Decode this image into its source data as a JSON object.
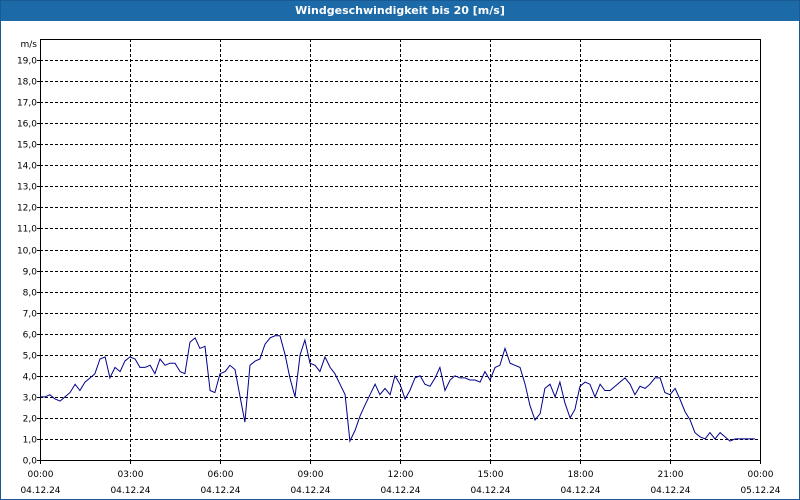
{
  "window": {
    "title": "Windgeschwindigkeit bis 20 [m/s]"
  },
  "chart_data": {
    "type": "line",
    "title": "Windgeschwindigkeit bis 20 [m/s]",
    "ylabel": "m/s",
    "xlabel": "",
    "ylim": [
      0,
      20
    ],
    "xlim": [
      0,
      24
    ],
    "grid": true,
    "line_color": "#00008b",
    "y_ticks": [
      "0,0",
      "1,0",
      "2,0",
      "3,0",
      "4,0",
      "5,0",
      "6,0",
      "7,0",
      "8,0",
      "9,0",
      "10,0",
      "11,0",
      "12,0",
      "13,0",
      "14,0",
      "15,0",
      "16,0",
      "17,0",
      "18,0",
      "19,0"
    ],
    "x_ticks": [
      {
        "time": "00:00",
        "date": "04.12.24"
      },
      {
        "time": "03:00",
        "date": "04.12.24"
      },
      {
        "time": "06:00",
        "date": "04.12.24"
      },
      {
        "time": "09:00",
        "date": "04.12.24"
      },
      {
        "time": "12:00",
        "date": "04.12.24"
      },
      {
        "time": "15:00",
        "date": "04.12.24"
      },
      {
        "time": "18:00",
        "date": "04.12.24"
      },
      {
        "time": "21:00",
        "date": "04.12.24"
      },
      {
        "time": "00:00",
        "date": "05.12.24"
      }
    ],
    "series": [
      {
        "x": [
          0,
          0.17,
          0.33,
          0.5,
          0.67,
          0.83,
          1,
          1.17,
          1.33,
          1.5,
          1.67,
          1.83,
          2,
          2.17,
          2.33,
          2.5,
          2.67,
          2.83,
          3,
          3.17,
          3.33,
          3.5,
          3.67,
          3.83,
          4,
          4.17,
          4.33,
          4.5,
          4.67,
          4.83,
          5,
          5.17,
          5.33,
          5.5,
          5.67,
          5.83,
          6,
          6.17,
          6.33,
          6.5,
          6.67,
          6.83,
          7,
          7.17,
          7.33,
          7.5,
          7.67,
          7.83,
          8,
          8.17,
          8.33,
          8.5,
          8.67,
          8.83,
          9,
          9.17,
          9.33,
          9.5,
          9.67,
          9.83,
          10,
          10.17,
          10.33,
          10.5,
          10.67,
          10.83,
          11,
          11.17,
          11.33,
          11.5,
          11.67,
          11.83,
          12,
          12.17,
          12.33,
          12.5,
          12.67,
          12.83,
          13,
          13.17,
          13.33,
          13.5,
          13.67,
          13.83,
          14,
          14.17,
          14.33,
          14.5,
          14.67,
          14.83,
          15,
          15.17,
          15.33,
          15.5,
          15.67,
          15.83,
          16,
          16.17,
          16.33,
          16.5,
          16.67,
          16.83,
          17,
          17.17,
          17.33,
          17.5,
          17.67,
          17.83,
          18,
          18.17,
          18.33,
          18.5,
          18.67,
          18.83,
          19,
          19.17,
          19.33,
          19.5,
          19.67,
          19.83,
          20,
          20.17,
          20.33,
          20.5,
          20.67,
          20.83,
          21,
          21.17,
          21.33,
          21.5,
          21.67,
          21.83,
          22,
          22.17,
          22.33,
          22.5,
          22.67,
          22.83,
          23,
          23.17,
          23.33,
          23.5,
          23.67,
          23.83
        ],
        "values": [
          3.0,
          3.0,
          3.1,
          2.9,
          2.8,
          3.0,
          3.2,
          3.6,
          3.3,
          3.7,
          3.9,
          4.1,
          4.8,
          4.9,
          3.9,
          4.4,
          4.2,
          4.7,
          4.9,
          4.8,
          4.4,
          4.4,
          4.5,
          4.1,
          4.8,
          4.5,
          4.6,
          4.6,
          4.2,
          4.1,
          5.6,
          5.8,
          5.3,
          5.4,
          3.3,
          3.2,
          4.1,
          4.2,
          4.5,
          4.3,
          3.0,
          1.8,
          4.5,
          4.7,
          4.8,
          5.5,
          5.8,
          5.9,
          5.9,
          5.0,
          3.9,
          3.0,
          5.0,
          5.7,
          4.6,
          4.5,
          4.2,
          4.9,
          4.4,
          4.1,
          3.6,
          3.1,
          0.9,
          1.4,
          2.1,
          2.6,
          3.1,
          3.6,
          3.1,
          3.4,
          3.1,
          4.0,
          3.6,
          2.9,
          3.3,
          3.9,
          4.0,
          3.6,
          3.5,
          3.9,
          4.4,
          3.3,
          3.8,
          4.0,
          3.9,
          3.9,
          3.8,
          3.8,
          3.7,
          4.2,
          3.8,
          4.4,
          4.5,
          5.3,
          4.6,
          4.5,
          4.4,
          3.6,
          2.6,
          1.9,
          2.2,
          3.4,
          3.6,
          3.0,
          3.7,
          2.7,
          2.0,
          2.4,
          3.5,
          3.7,
          3.6,
          3.0,
          3.6,
          3.3,
          3.3,
          3.5,
          3.7,
          3.9,
          3.6,
          3.1,
          3.5,
          3.4,
          3.6,
          3.9,
          3.9,
          3.2,
          3.1,
          3.4,
          2.9,
          2.3,
          1.9,
          1.3,
          1.1,
          1.0,
          1.3,
          1.0,
          1.3,
          1.1,
          0.9,
          1.0,
          1.0,
          1.0,
          1.0,
          1.0
        ]
      }
    ]
  }
}
